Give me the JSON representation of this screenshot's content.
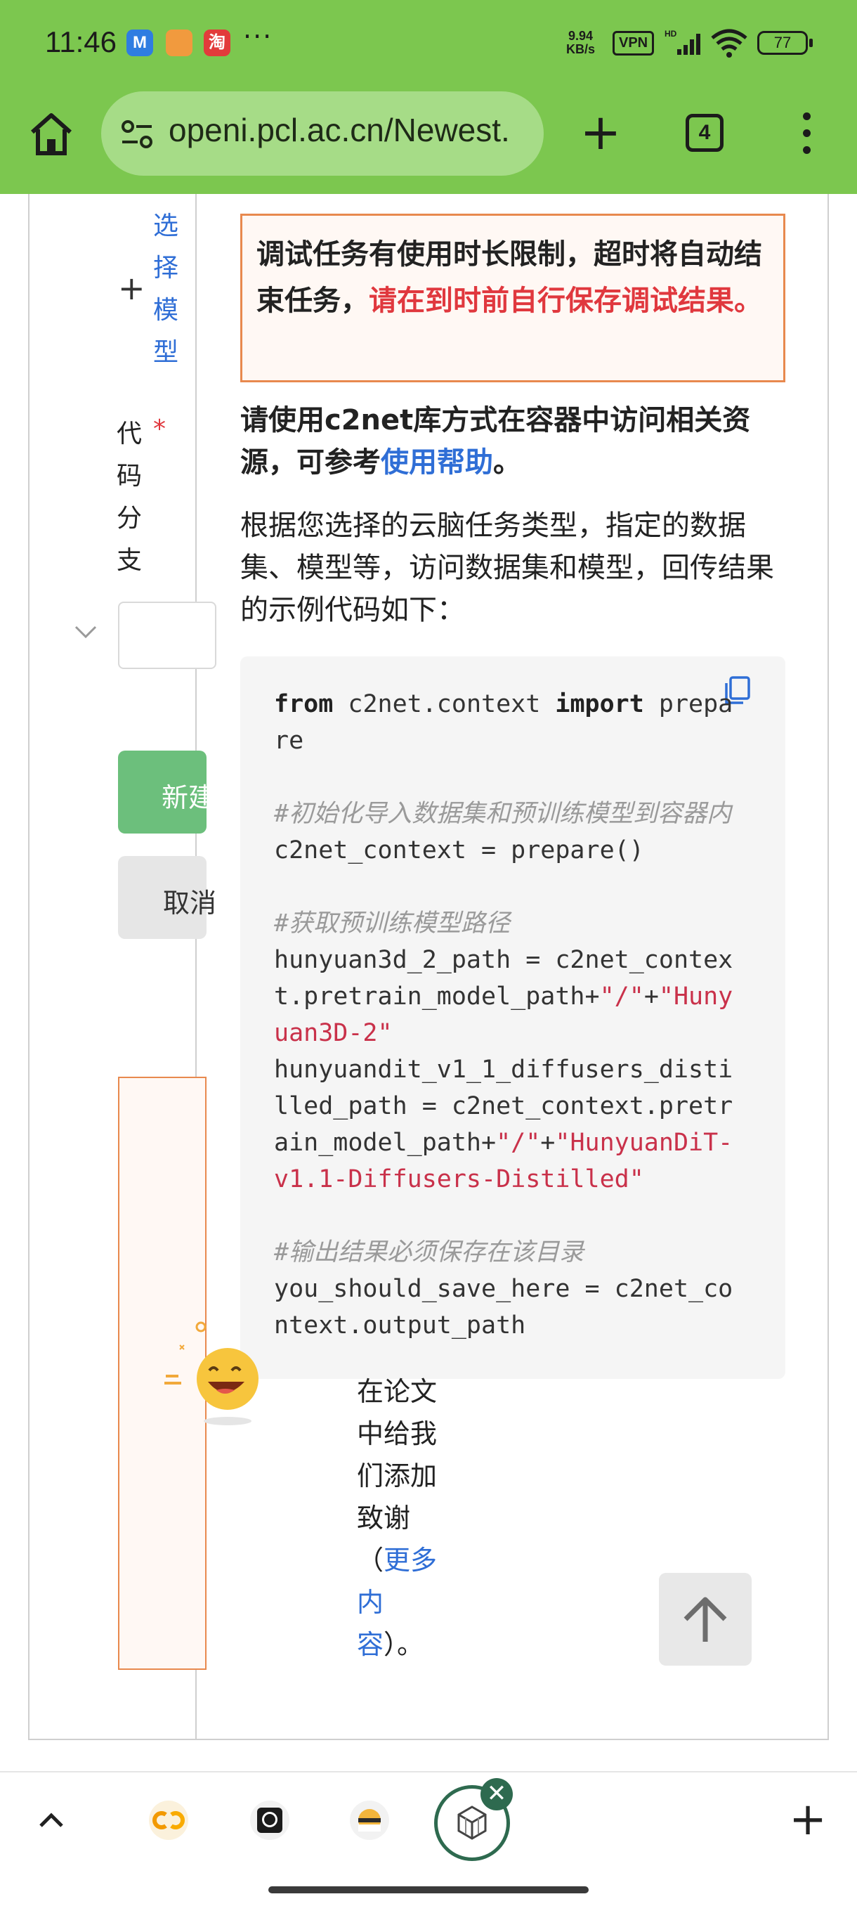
{
  "status_bar": {
    "time": "11:46",
    "apps": [
      "M",
      "淘"
    ],
    "more": "···",
    "net_speed": "9.94",
    "net_unit": "KB/s",
    "vpn": "VPN",
    "signal_tag": "HD",
    "battery": "77"
  },
  "browser": {
    "url": "openi.pcl.ac.cn/Newest.",
    "tab_count": "4",
    "icons": [
      "home-icon",
      "tune-icon",
      "plus-icon",
      "tab-switcher-icon",
      "more-vert-icon"
    ]
  },
  "form": {
    "select_model_link": "选择模型",
    "branch_label": "代码分支",
    "required_mark": "*",
    "create_button": "新建",
    "cancel_button": "取消"
  },
  "notice": {
    "warning_prefix": "调试任务有使用时长限制，超时将自动结束任务，",
    "warning_highlight": "请在到时前自行保存调试结果。",
    "usage_prefix": "请使用c2net库方式在容器中访问相关资源，可参考",
    "usage_link": "使用帮助",
    "usage_suffix": "。",
    "description": "根据您选择的云脑任务类型，指定的数据集、模型等，访问数据集和模型，回传结果的示例代码如下："
  },
  "code": {
    "line1_kw1": "from",
    "line1_mod": " c2net.context ",
    "line1_kw2": "import",
    "line1_rest": " prepa",
    "line2": "re",
    "comment1": "#初始化导入数据集和预训练模型到容器内",
    "line_prepare": "c2net_context = prepare()",
    "comment2": "#获取预训练模型路径",
    "h3d_a": "hunyuan3d_2_path = c2net_contex",
    "h3d_b1": "t.pretrain_model_path+",
    "h3d_b2": "\"/\"",
    "h3d_b3": "+",
    "h3d_b4": "\"Huny",
    "h3d_c": "uan3D-2\"",
    "dit_a": "hunyuandit_v1_1_diffusers_disti",
    "dit_b": "lled_path = c2net_context.pretr",
    "dit_c1": "ain_model_path+",
    "dit_c2": "\"/\"",
    "dit_c3": "+",
    "dit_c4": "\"HunyuanDiT-",
    "dit_d": "v1.1-Diffusers-Distilled\"",
    "comment3": "#输出结果必须保存在该目录",
    "out_a": "you_should_save_here = c2net_co",
    "out_b": "ntext.output_path"
  },
  "acknowledgement": {
    "text": "在论文中给我们添加致谢（",
    "link": "更多内容",
    "suffix": "）。"
  },
  "bottom_bar": {
    "tab_icons": [
      "colab-icon",
      "github-icon",
      "favicon-icon",
      "openi-cube-icon"
    ],
    "close_symbol": "✕",
    "new_tab_symbol": "+"
  },
  "colors": {
    "chrome_green": "#7cc74f",
    "url_pill": "#a6dc87",
    "accent_blue": "#2f6ed6",
    "warning_red": "#e0383e",
    "warning_border": "#e8894e",
    "create_green": "#6cbf7c",
    "active_tab": "#2e6a4f"
  }
}
